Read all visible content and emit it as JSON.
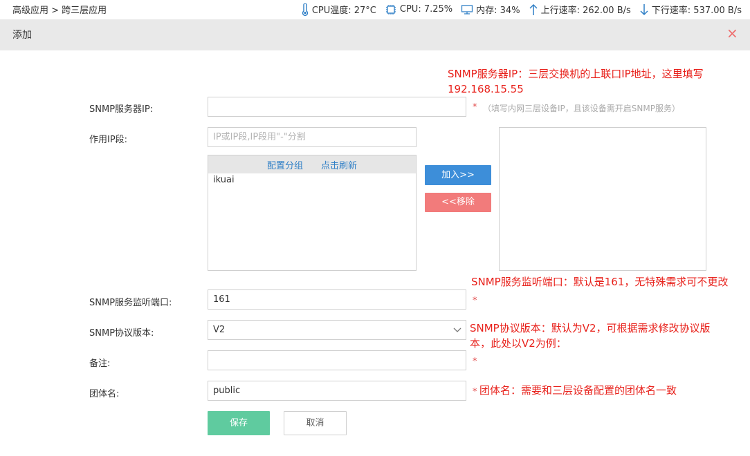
{
  "breadcrumb": "高级应用 > 跨三层应用",
  "stats": {
    "cpu_temp": "CPU温度: 27°C",
    "cpu": "CPU: 7.25%",
    "memory": "内存: 34%",
    "upload": "上行速率: 262.00 B/s",
    "download": "下行速率: 537.00 B/s"
  },
  "dialog": {
    "title": "添加",
    "close": "×"
  },
  "form": {
    "snmp_ip_label": "SNMP服务器IP:",
    "snmp_ip_value": "",
    "required_mark": "*",
    "snmp_ip_hint": "（填写内网三层设备IP，且该设备需开启SNMP服务）",
    "ip_range_label": "作用IP段:",
    "ip_range_placeholder": "IP或IP段,IP段用\"-\"分割",
    "group_link": "配置分组",
    "refresh_link": "点击刷新",
    "group_items": [
      "ikuai"
    ],
    "add_button": "加入>>",
    "remove_button": "<<移除",
    "port_label": "SNMP服务监听端口:",
    "port_value": "161",
    "version_label": "SNMP协议版本:",
    "version_value": "V2",
    "remark_label": "备注:",
    "remark_value": "",
    "community_label": "团体名:",
    "community_value": "public",
    "save_button": "保存",
    "cancel_button": "取消"
  },
  "annotations": {
    "snmp_ip_line1": "SNMP服务器IP：三层交换机的上联口IP地址，这里填写",
    "snmp_ip_line2": "192.168.15.55",
    "port": "SNMP服务监听端口：默认是161，无特殊需求可不更改",
    "version_line1": "SNMP协议版本：默认为V2，可根据需求修改协议版",
    "version_line2": "本，此处以V2为例：",
    "community": "团体名：需要和三层设备配置的团体名一致"
  },
  "colors": {
    "accent_blue": "#3d8ed9",
    "remove_red": "#f27b7b",
    "save_green": "#5fcb9f",
    "annotation_red": "#e8211b",
    "link_blue": "#2f7fc6"
  }
}
